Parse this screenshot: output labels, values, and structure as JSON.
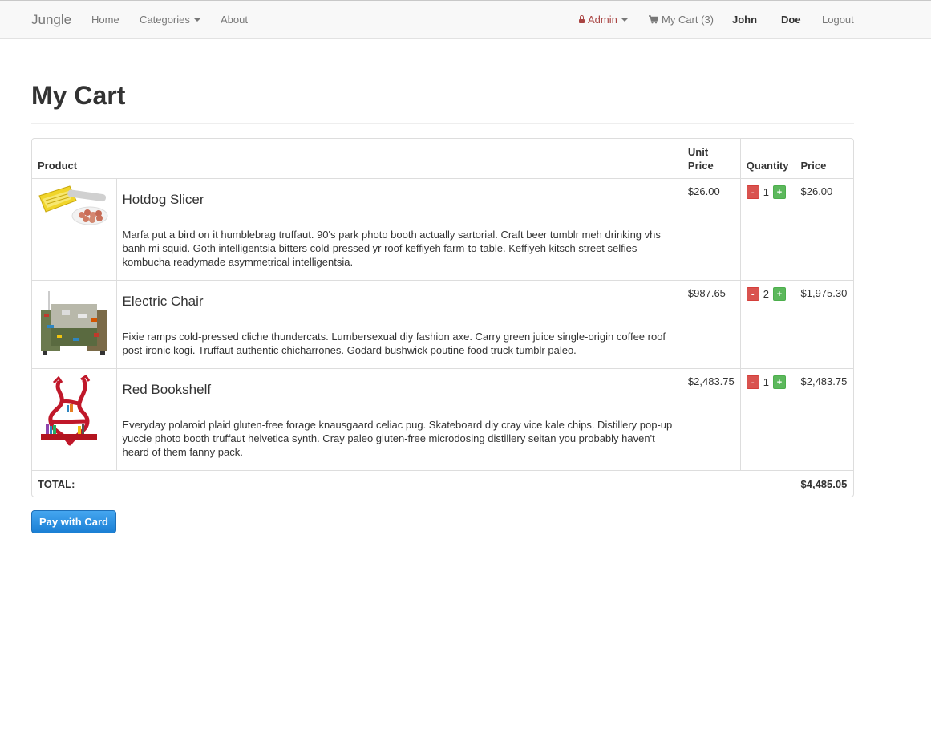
{
  "nav": {
    "brand": "Jungle",
    "home": "Home",
    "categories": "Categories",
    "about": "About",
    "admin": "Admin",
    "cart": "My Cart (3)",
    "first_name": "John",
    "last_name": "Doe",
    "logout": "Logout"
  },
  "page": {
    "title": "My Cart"
  },
  "table": {
    "headers": {
      "product": "Product",
      "unit_price": "Unit Price",
      "quantity": "Quantity",
      "price": "Price"
    },
    "items": [
      {
        "name": "Hotdog Slicer",
        "description": "Marfa put a bird on it humblebrag truffaut. 90's park photo booth actually sartorial. Craft beer tumblr meh drinking vhs banh mi squid. Goth intelligentsia bitters cold-pressed yr roof keffiyeh farm-to-table. Keffiyeh kitsch street selfies kombucha readymade asymmetrical intelligentsia.",
        "unit_price": "$26.00",
        "quantity": "1",
        "price": "$26.00",
        "image_icon": "hotdog-slicer-image"
      },
      {
        "name": "Electric Chair",
        "description": "Fixie ramps cold-pressed cliche thundercats. Lumbersexual diy fashion axe. Carry green juice single-origin coffee roof post-ironic kogi. Truffaut authentic chicharrones. Godard bushwick poutine food truck tumblr paleo.",
        "unit_price": "$987.65",
        "quantity": "2",
        "price": "$1,975.30",
        "image_icon": "electric-chair-image"
      },
      {
        "name": "Red Bookshelf",
        "description": "Everyday polaroid plaid gluten-free forage knausgaard celiac pug. Skateboard diy cray vice kale chips. Distillery pop-up yuccie photo booth truffaut helvetica synth. Cray paleo gluten-free microdosing distillery seitan you probably haven't heard of them fanny pack.",
        "unit_price": "$2,483.75",
        "quantity": "1",
        "price": "$2,483.75",
        "image_icon": "red-bookshelf-image"
      }
    ],
    "minus_label": "-",
    "plus_label": "+",
    "total_label": "TOTAL:",
    "total_value": "$4,485.05"
  },
  "actions": {
    "pay_label": "Pay with Card"
  },
  "colors": {
    "admin": "#a94442",
    "minus_button": "#d9534f",
    "plus_button": "#5cb85c",
    "pay_button": "#2a8ee0"
  }
}
